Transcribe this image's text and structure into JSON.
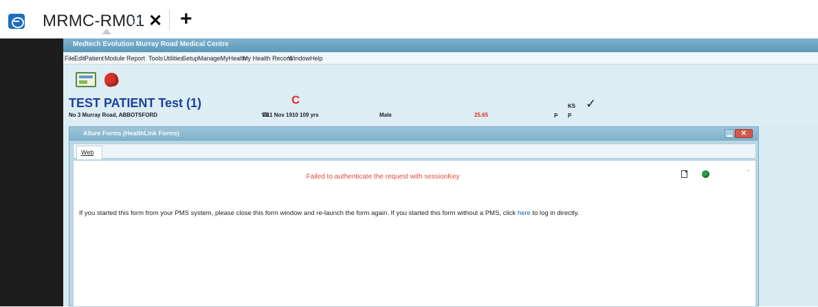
{
  "tabbar": {
    "logo_icon": "teamviewer-icon",
    "title": "MRMC-RM01",
    "favorite_icon": "star-icon",
    "close_icon": "close-icon",
    "new_tab_icon": "plus-icon"
  },
  "app": {
    "title": "Medtech Evolution  Murray Road Medical Centre",
    "menu": [
      "File",
      "Edit",
      "Patient",
      "Module",
      "Report",
      "Tools",
      "Utilities",
      "Setup",
      "ManageMyHealth",
      "My Health Record",
      "Window",
      "Help"
    ]
  },
  "patient": {
    "name": "TEST PATIENT Test (1)",
    "address": "No 3 Murray Road, ABBOTSFORD",
    "flag": "C",
    "dob": "11 Nov 1910 109 yrs",
    "sex": "Male",
    "bmi": "25.65",
    "ks": "KS",
    "check": "✓",
    "p1": "P",
    "p2": "P"
  },
  "window": {
    "title": "Allure Forms (HealthLink Forms)",
    "close_label": "✕",
    "tab_label": "Web",
    "error_message": "Failed to authenticate the request with sessionKey",
    "body_before_link": "If you started this form from your PMS system, please close this form window and re-launch the form again. If you started this form without a PMS, click ",
    "link_text": "here",
    "body_after_link": " to log in directly."
  },
  "colors": {
    "patient_name": "#1b3fa0",
    "error_red": "#e0483c",
    "link_blue": "#1a5fb4",
    "title_bar": "#7fb0c9"
  }
}
